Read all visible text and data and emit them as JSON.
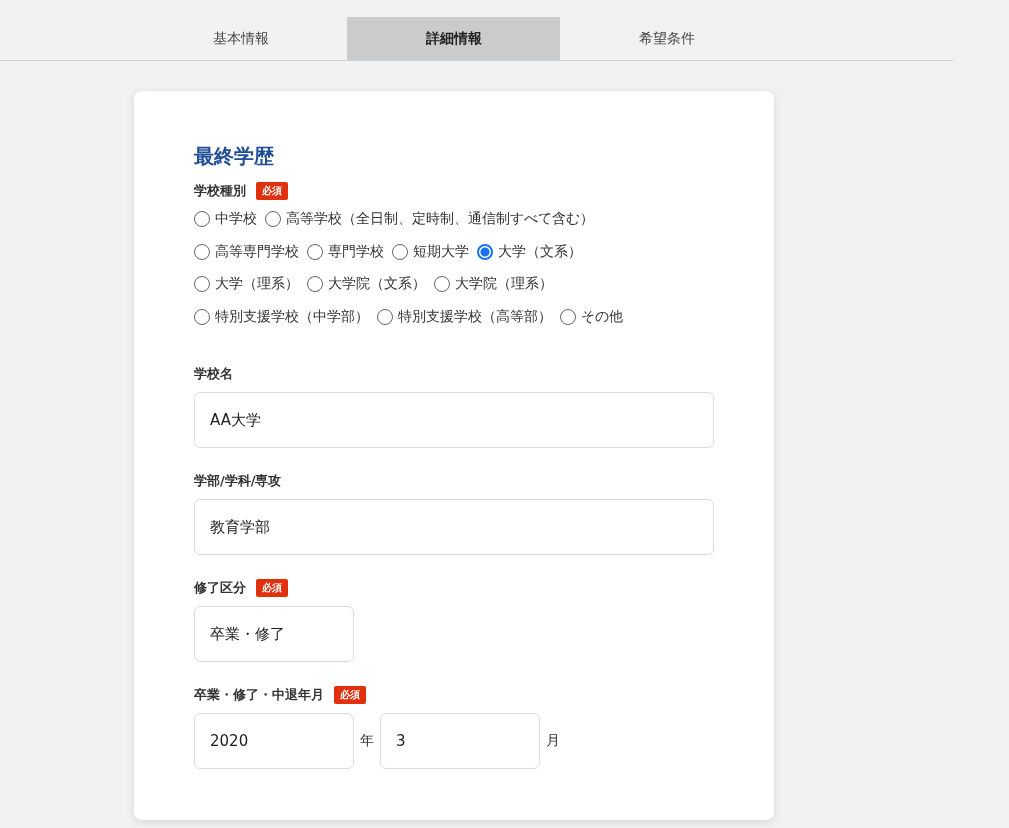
{
  "tabs": [
    {
      "label": "基本情報",
      "selected": false
    },
    {
      "label": "詳細情報",
      "selected": true
    },
    {
      "label": "希望条件",
      "selected": false
    }
  ],
  "section_title": "最終学歴",
  "school_type": {
    "label": "学校種別",
    "required_badge": "必須",
    "option_rows": [
      [
        {
          "label": "中学校",
          "selected": false
        },
        {
          "label": "高等学校（全日制、定時制、通信制すべて含む）",
          "selected": false
        }
      ],
      [
        {
          "label": "高等専門学校",
          "selected": false
        },
        {
          "label": "専門学校",
          "selected": false
        },
        {
          "label": "短期大学",
          "selected": false
        },
        {
          "label": "大学（文系）",
          "selected": true
        }
      ],
      [
        {
          "label": "大学（理系）",
          "selected": false
        },
        {
          "label": "大学院（文系）",
          "selected": false
        },
        {
          "label": "大学院（理系）",
          "selected": false
        }
      ],
      [
        {
          "label": "特別支援学校（中学部）",
          "selected": false
        },
        {
          "label": "特別支援学校（高等部）",
          "selected": false
        },
        {
          "label": "その他",
          "selected": false
        }
      ]
    ]
  },
  "school_name": {
    "label": "学校名",
    "value": "AA大学"
  },
  "faculty": {
    "label": "学部/学科/専攻",
    "value": "教育学部"
  },
  "completion_type": {
    "label": "修了区分",
    "required_badge": "必須",
    "value": "卒業・修了"
  },
  "graduation_date": {
    "label": "卒業・修了・中退年月",
    "required_badge": "必須",
    "year": "2020",
    "year_unit": "年",
    "month": "3",
    "month_unit": "月"
  }
}
